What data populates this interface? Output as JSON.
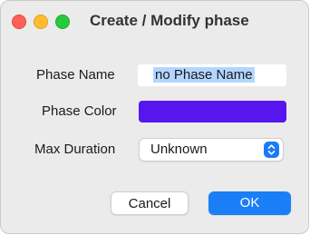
{
  "window": {
    "title": "Create / Modify phase",
    "controls": {
      "close_color": "#fe5f57",
      "minimize_color": "#febc2e",
      "zoom_color": "#28c840"
    }
  },
  "form": {
    "phase_name": {
      "label": "Phase Name",
      "value": "no Phase Name",
      "selected": true
    },
    "phase_color": {
      "label": "Phase Color",
      "value": "#5716ee"
    },
    "max_duration": {
      "label": "Max Duration",
      "value": "Unknown",
      "icon": "chevron-updown-icon"
    }
  },
  "buttons": {
    "cancel_label": "Cancel",
    "ok_label": "OK"
  },
  "colors": {
    "accent": "#1a7ff7",
    "selection": "#b3d6ff",
    "window_bg": "#ebebeb"
  }
}
